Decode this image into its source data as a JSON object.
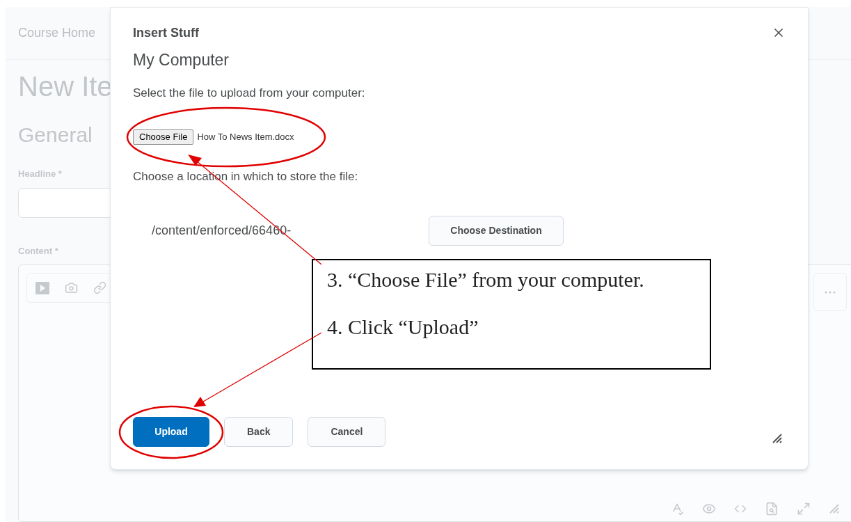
{
  "page": {
    "breadcrumb": "Course Home",
    "title": "New Ite",
    "section": "General",
    "fields": [
      {
        "label": "Headline *",
        "kind": "input"
      },
      {
        "label": "Content *",
        "kind": "editor"
      }
    ]
  },
  "dialog": {
    "title": "Insert Stuff",
    "subtitle": "My Computer",
    "file_prompt": "Select the file to upload from your computer:",
    "file_button": "Choose File",
    "file_name": "How To News Item.docx",
    "location_prompt": "Choose a location in which to store the file:",
    "path": "/content/enforced/66460-",
    "destination_button": "Choose Destination",
    "buttons": [
      {
        "label": "Upload",
        "kind": "primary"
      },
      {
        "label": "Back",
        "kind": "secondary"
      },
      {
        "label": "Cancel",
        "kind": "secondary"
      }
    ]
  },
  "annotation": {
    "steps": [
      "3. “Choose File” from your computer.",
      "4. Click “Upload”"
    ]
  }
}
